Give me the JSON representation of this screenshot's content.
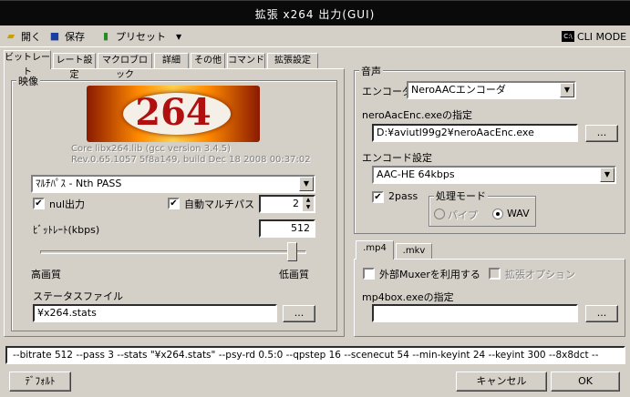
{
  "window": {
    "title": "拡張 x264 出力(GUI)"
  },
  "toolbar": {
    "open": "開く",
    "save": "保存",
    "preset": "プリセット",
    "cli_mode": "CLI MODE"
  },
  "tabs": [
    "ビットレート",
    "レート設定",
    "マクロブロック",
    "詳細",
    "その他",
    "コマンド",
    "拡張設定"
  ],
  "video": {
    "legend": "映像",
    "logo_text": "264",
    "core_line": "Core libx264.lib (gcc version 3.4.5)",
    "rev_line": "Rev.0.65.1057 5f8a149, build Dec 18 2008 00:37:02",
    "mode_value": "ﾏﾙﾁﾊﾟｽ - Nth PASS",
    "nul_label": "nul出力",
    "auto_multipass_label": "自動マルチパス",
    "passes_value": "2",
    "bitrate_label": "ﾋﾞｯﾄﾚｰﾄ(kbps)",
    "bitrate_value": "512",
    "slider_fraction": 0.95,
    "high_quality": "高画質",
    "low_quality": "低画質",
    "stats_label": "ステータスファイル",
    "stats_value": "¥x264.stats",
    "browse": "..."
  },
  "audio": {
    "legend": "音声",
    "encoder_label": "エンコーダ",
    "encoder_value": "NeroAACエンコーダ",
    "exe_label": "neroAacEnc.exeの指定",
    "exe_value": "D:¥aviutl99g2¥neroAacEnc.exe",
    "browse": "...",
    "encode_settings_label": "エンコード設定",
    "encode_settings_value": "AAC-HE 64kbps",
    "twopass_label": "2pass",
    "proc_mode_legend": "処理モード",
    "pipe_label": "パイプ",
    "wav_label": "WAV"
  },
  "container": {
    "tabs": [
      ".mp4",
      ".mkv"
    ],
    "external_muxer_label": "外部Muxerを利用する",
    "ext_option_label": "拡張オプション",
    "mp4box_label": "mp4box.exeの指定",
    "mp4box_value": "",
    "browse": "..."
  },
  "command_line": "--bitrate 512 --pass 3 --stats \"¥x264.stats\" --psy-rd 0.5:0 --qpstep 16 --scenecut 54 --min-keyint 24 --keyint 300 --8x8dct --",
  "buttons": {
    "default": "ﾃﾞﾌｫﾙﾄ",
    "cancel": "キャンセル",
    "ok": "OK"
  }
}
